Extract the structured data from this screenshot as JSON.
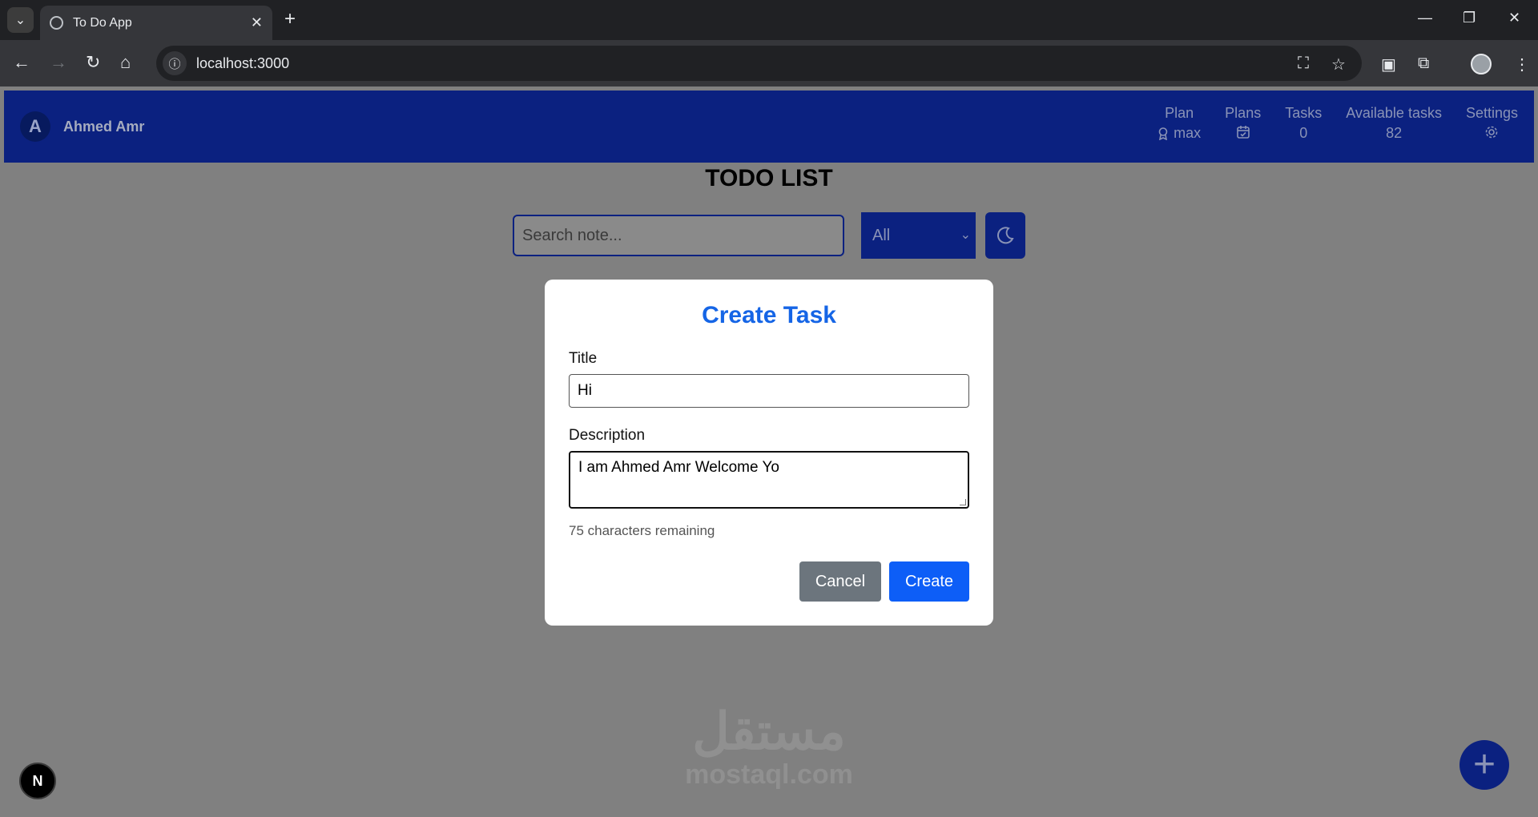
{
  "browser": {
    "tab_title": "To Do App",
    "url": "localhost:3000"
  },
  "navbar": {
    "avatar_letter": "A",
    "user_name": "Ahmed Amr",
    "plan_label": "Plan",
    "plan_value": "max",
    "plans_label": "Plans",
    "tasks_label": "Tasks",
    "tasks_value": "0",
    "available_label": "Available tasks",
    "available_value": "82",
    "settings_label": "Settings"
  },
  "main": {
    "title": "TODO LIST",
    "search_placeholder": "Search note...",
    "filter_value": "All"
  },
  "modal": {
    "heading": "Create Task",
    "title_label": "Title",
    "title_value": "Hi",
    "description_label": "Description",
    "description_value": "I am Ahmed Amr Welcome Yo",
    "remaining_text": "75 characters remaining",
    "cancel_label": "Cancel",
    "create_label": "Create"
  },
  "watermark": {
    "arabic": "مستقل",
    "latin": "mostaql.com"
  },
  "dev_badge": "N",
  "colors": {
    "navbar": "#0b2180",
    "accent": "#1565e6",
    "create_button": "#0d5ef7",
    "cancel_button": "#6c757d"
  }
}
